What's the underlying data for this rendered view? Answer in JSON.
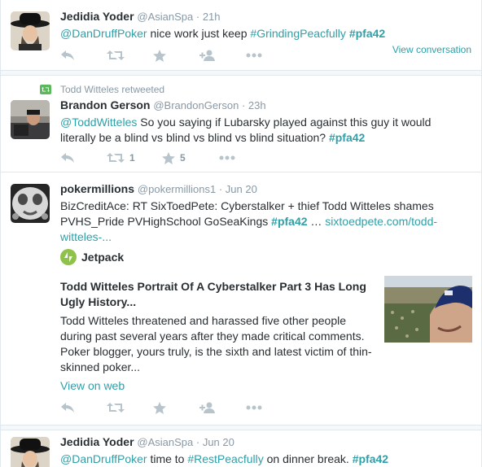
{
  "tweets": [
    {
      "fullname": "Jedidia Yoder",
      "username": "@AsianSpa",
      "time": "21h",
      "text_parts": [
        {
          "t": "@DanDruffPoker",
          "kind": "link"
        },
        {
          "t": " nice work just keep ",
          "kind": "plain"
        },
        {
          "t": "#GrindingPeacfully",
          "kind": "tag"
        },
        {
          "t": " ",
          "kind": "plain"
        },
        {
          "t": "#pfa42",
          "kind": "tagbold"
        }
      ],
      "view_conversation": "View conversation",
      "counts": {
        "retweet": "",
        "favorite": ""
      }
    },
    {
      "context": "Todd Witteles retweeted",
      "fullname": "Brandon Gerson",
      "username": "@BrandonGerson",
      "time": "23h",
      "text_line1_parts": [
        {
          "t": "@ToddWitteles",
          "kind": "link"
        },
        {
          "t": " So you saying if Lubarsky played against this guy it would",
          "kind": "plain"
        }
      ],
      "text_line2_parts": [
        {
          "t": "literally be a blind vs blind vs  blind vs blind situation? ",
          "kind": "plain"
        },
        {
          "t": "#pfa42",
          "kind": "tagbold"
        }
      ],
      "counts": {
        "retweet": "1",
        "favorite": "5"
      }
    },
    {
      "fullname": "pokermillions",
      "username": "@pokermillions1",
      "time": "Jun 20",
      "line1": "BizCreditAce: RT SixToedPete: Cyberstalker + thief Todd Witteles shames",
      "line2_plain": "PVHS_Pride PVHighSchool GoSeaKings ",
      "line2_tag": "#pfa42",
      "line2_ellipsis": " … ",
      "line2_link": "sixtoedpete.com/todd-",
      "line3_link": "witteles-...",
      "card": {
        "site": "Jetpack",
        "title": "Todd Witteles Portrait Of A Cyberstalker Part 3 Has Long Ugly History...",
        "description": "Todd Witteles threatened and harassed five other people during past several years after they made critical comments. Poker blogger, yours truly, is the sixth and latest victim of thin-skinned poker...",
        "view_web": "View on web"
      },
      "counts": {
        "retweet": "",
        "favorite": ""
      }
    },
    {
      "fullname": "Jedidia Yoder",
      "username": "@AsianSpa",
      "time": "Jun 20",
      "text_parts": [
        {
          "t": "@DanDruffPoker",
          "kind": "link"
        },
        {
          "t": " time to ",
          "kind": "plain"
        },
        {
          "t": "#RestPeacfully",
          "kind": "tag"
        },
        {
          "t": " on dinner break. ",
          "kind": "plain"
        },
        {
          "t": "#pfa42",
          "kind": "tagbold"
        }
      ]
    }
  ],
  "ui": {
    "separator_dot": " · ",
    "icons": [
      "reply-icon",
      "retweet-icon",
      "favorite-icon",
      "follow-icon",
      "more-icon"
    ]
  },
  "colors": {
    "link": "#2fa0a8",
    "muted": "#8899a6",
    "action_icon": "#b8c4cc",
    "text": "#292f33",
    "jetpack": "#8ec24a"
  }
}
